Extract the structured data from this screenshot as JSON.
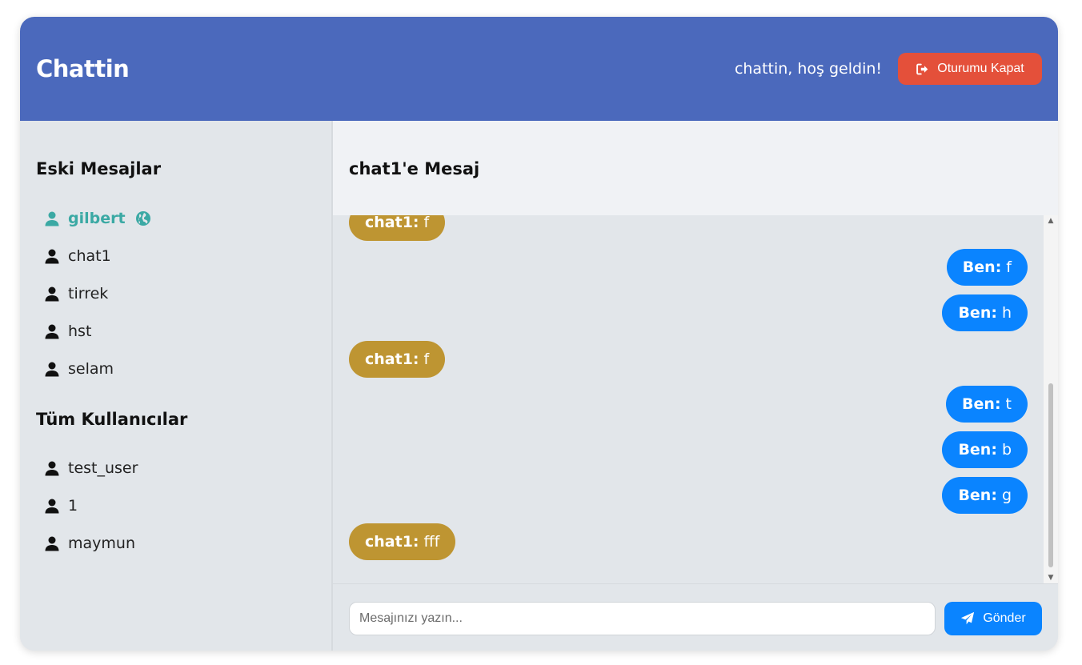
{
  "header": {
    "title": "Chattin",
    "welcome": "chattin, hoş geldin!",
    "logout_label": "Oturumu Kapat",
    "logout_icon": "sign-out-icon"
  },
  "sidebar": {
    "recent_title": "Eski Mesajlar",
    "recent": [
      {
        "name": "gilbert",
        "active": true,
        "online_icon": "globe-icon"
      },
      {
        "name": "chat1"
      },
      {
        "name": "tirrek"
      },
      {
        "name": "hst"
      },
      {
        "name": "selam"
      }
    ],
    "all_title": "Tüm Kullanıcılar",
    "all": [
      {
        "name": "test_user"
      },
      {
        "name": "1"
      },
      {
        "name": "maymun"
      }
    ]
  },
  "chat": {
    "title": "chat1'e Mesaj",
    "messages": [
      {
        "sender": "chat1:",
        "text": "f",
        "mine": false
      },
      {
        "sender": "Ben:",
        "text": "f",
        "mine": true
      },
      {
        "sender": "Ben:",
        "text": "h",
        "mine": true
      },
      {
        "sender": "chat1:",
        "text": "f",
        "mine": false
      },
      {
        "sender": "Ben:",
        "text": "t",
        "mine": true
      },
      {
        "sender": "Ben:",
        "text": "b",
        "mine": true
      },
      {
        "sender": "Ben:",
        "text": "g",
        "mine": true
      },
      {
        "sender": "chat1:",
        "text": "fff",
        "mine": false
      }
    ]
  },
  "composer": {
    "placeholder": "Mesajınızı yazın...",
    "send_label": "Gönder",
    "send_icon": "paper-plane-icon"
  },
  "colors": {
    "header": "#4b69bc",
    "logout": "#e4503a",
    "my_bubble": "#0a84ff",
    "their_bubble": "#be9532",
    "active_user": "#3ba9a4"
  }
}
